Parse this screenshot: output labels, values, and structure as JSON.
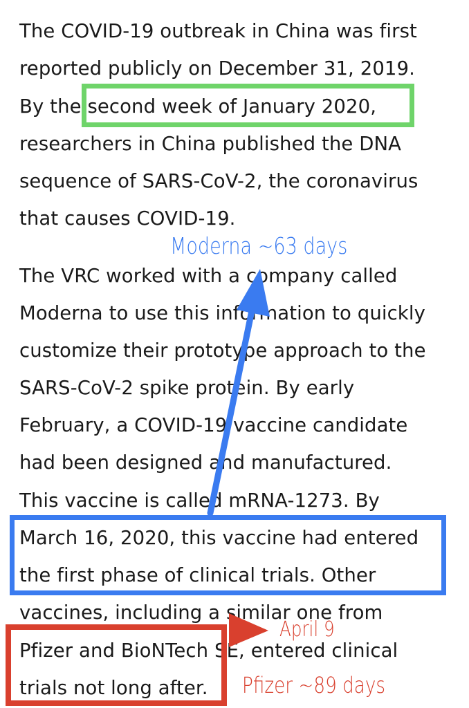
{
  "article": {
    "lines": [
      "The COVID-19 outbreak in China was first",
      "reported publicly on December 31, 2019.",
      "By the second week of January 2020,",
      "researchers in China published the DNA",
      "sequence of SARS-CoV-2, the coronavirus",
      "that causes COVID-19.",
      "The VRC worked with a company called",
      "Moderna to use this information to quickly",
      "customize their prototype approach to the",
      "SARS-CoV-2 spike protein. By early",
      "February, a COVID-19 vaccine candidate",
      "had been designed and manufactured.",
      "This vaccine is called mRNA-1273. By",
      "March 16, 2020, this vaccine had entered",
      "the first phase of clinical trials. Other",
      "vaccines, including a similar one from",
      "Pfizer and BioNTech SE, entered clinical",
      "trials not long after."
    ]
  },
  "annotations": {
    "moderna_label": "Moderna ~63 days",
    "april_label": "April 9",
    "pfizer_label": "Pfizer ~89 days",
    "colors": {
      "green": "#6fd46a",
      "blue": "#3a7bf0",
      "red": "#d9402e"
    }
  }
}
